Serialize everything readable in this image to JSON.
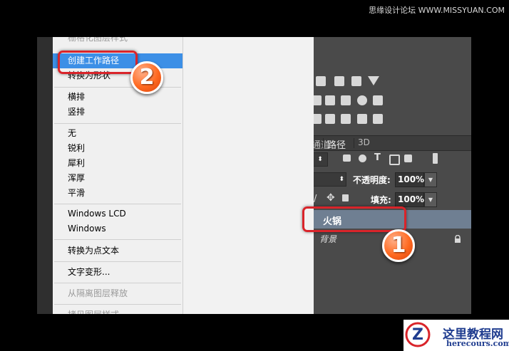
{
  "watermark_top": "思缘设计论坛 WWW.MISSYUAN.COM",
  "menu": {
    "items": [
      {
        "label": "栅格化图层样式",
        "state": "cut"
      },
      {
        "label": "创建工作路径",
        "state": "highlight"
      },
      {
        "label": "转换为形状"
      },
      {
        "label": "横排"
      },
      {
        "label": "竖排"
      },
      {
        "label": "无"
      },
      {
        "label": "锐利"
      },
      {
        "label": "犀利"
      },
      {
        "label": "浑厚"
      },
      {
        "label": "平滑"
      },
      {
        "label": "Windows LCD"
      },
      {
        "label": "Windows"
      },
      {
        "label": "转换为点文本"
      },
      {
        "label": "文字变形..."
      },
      {
        "label": "从隔离图层释放",
        "state": "disabled"
      },
      {
        "label": "拷贝图层样式",
        "state": "cut"
      }
    ]
  },
  "layers_panel": {
    "tabs": [
      "通道",
      "路径",
      "3D"
    ],
    "opacity_label": "不透明度:",
    "opacity_value": "100%",
    "fill_label": "填充:",
    "fill_value": "100%",
    "layers": [
      {
        "name": "火锅",
        "selected": true
      },
      {
        "name": "背景",
        "locked": true
      }
    ]
  },
  "callouts": {
    "one": "1",
    "two": "2"
  },
  "logo": {
    "title": "这里教程网",
    "subtitle": "herecours.com",
    "mark": "Z"
  },
  "colors": {
    "highlight": "#3c8fe6",
    "callout_red": "#d9242a",
    "badge_orange": "#ff6a21",
    "layer_selected": "#6f7f92"
  }
}
